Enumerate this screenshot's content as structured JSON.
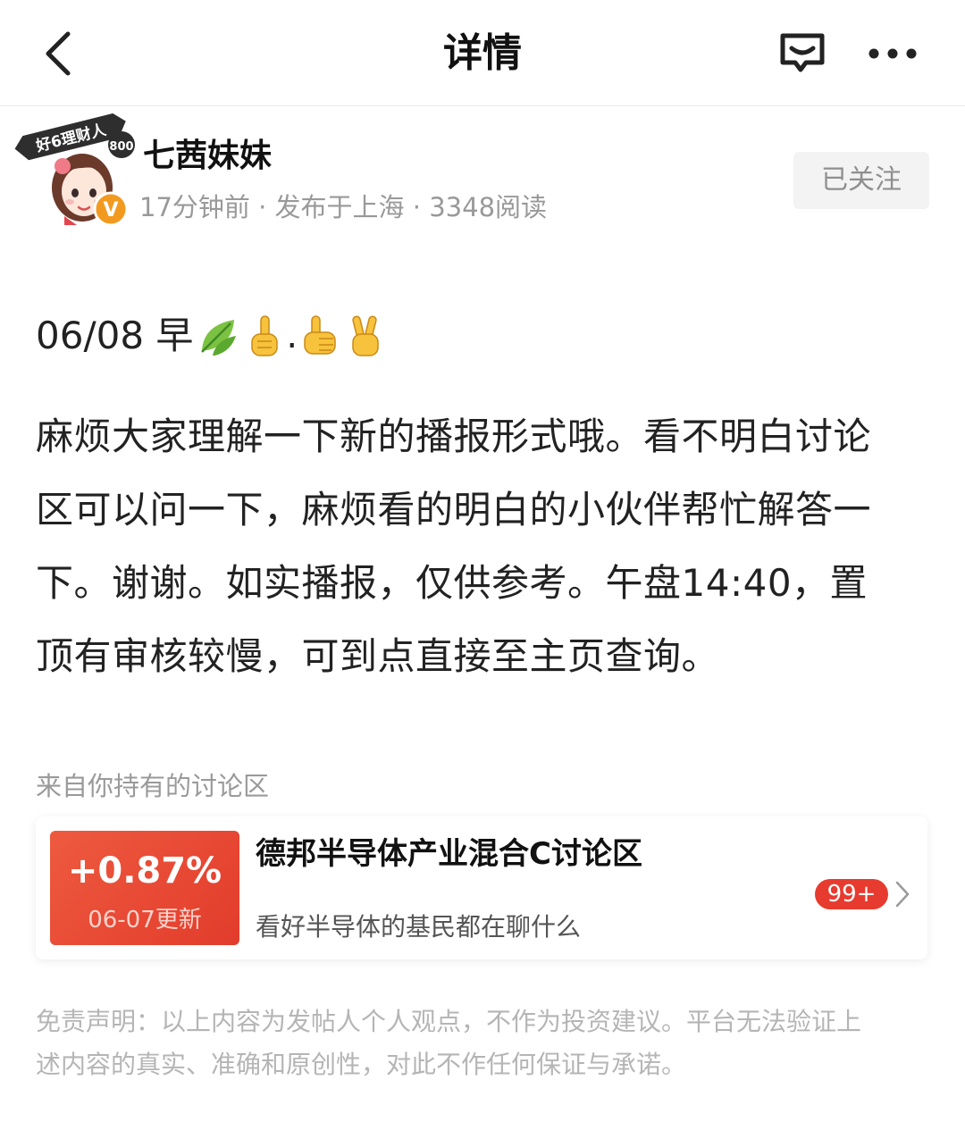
{
  "header": {
    "title": "详情",
    "back_icon": "chevron-left-icon",
    "comment_icon": "comment-icon",
    "more_icon": "more-dots-icon"
  },
  "author": {
    "name": "七茜妹妹",
    "badge_text": "好6理财人",
    "badge_number": "800",
    "verified_mark": "V",
    "meta": "17分钟前 · 发布于上海 · 3348阅读",
    "follow_label": "已关注"
  },
  "post": {
    "date_prefix": "06/08 早",
    "emoji_sep": ".",
    "emojis": [
      "leaf-emoji",
      "index-finger-up-emoji",
      "thumbs-up-emoji",
      "victory-hand-emoji"
    ],
    "lines": [
      "麻烦大家理解一下新的播报形式哦。看不明白讨论",
      "区可以问一下，麻烦看的明白的小伙伴帮忙解答一",
      "下。谢谢。如实播报，仅供参考。午盘14:40，置",
      "顶有审核较慢，可到点直接至主页查询。"
    ]
  },
  "discussion": {
    "section_label": "来自你持有的讨论区",
    "change_pct": "+0.87%",
    "update_date": "06-07更新",
    "title": "德邦半导体产业混合C讨论区",
    "subtitle": "看好半导体的基民都在聊什么",
    "count_badge": "99+"
  },
  "disclaimer": {
    "lines": [
      "免责声明：以上内容为发帖人个人观点，不作为投资建议。平台无法验证上",
      "述内容的真实、准确和原创性，对此不作任何保证与承诺。"
    ]
  },
  "colors": {
    "accent_red": "#e73b2f",
    "badge_orange": "#f29a1f",
    "muted_text": "#999999"
  }
}
